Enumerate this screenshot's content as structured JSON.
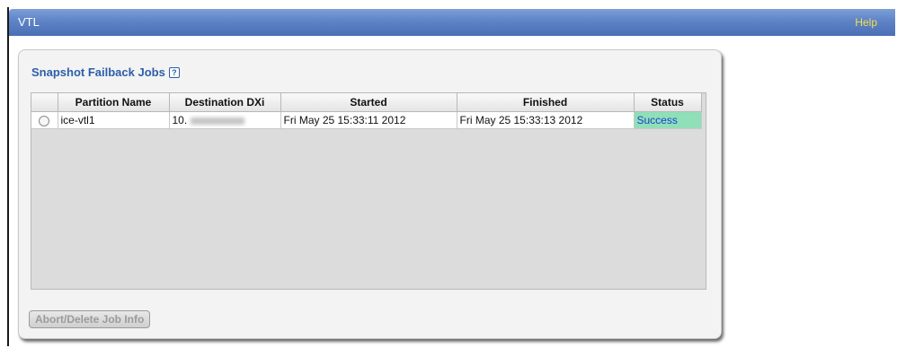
{
  "header": {
    "title": "VTL",
    "help_label": "Help"
  },
  "panel": {
    "title": "Snapshot Failback Jobs",
    "help_icon_label": "?"
  },
  "table": {
    "columns": [
      "",
      "Partition Name",
      "Destination DXi",
      "Started",
      "Finished",
      "Status"
    ],
    "rows": [
      {
        "partition_name": "ice-vtl1",
        "destination_dxi": "10.",
        "started": "Fri May 25 15:33:11 2012",
        "finished": "Fri May 25 15:33:13 2012",
        "status": "Success"
      }
    ]
  },
  "buttons": {
    "abort_label": "Abort/Delete Job Info"
  },
  "colors": {
    "header_bar": "#5e83c6",
    "help_link": "#f2e24a",
    "title_text": "#2c5ea8",
    "success_bg": "#8fe0b8",
    "success_text": "#1a3fd0"
  }
}
